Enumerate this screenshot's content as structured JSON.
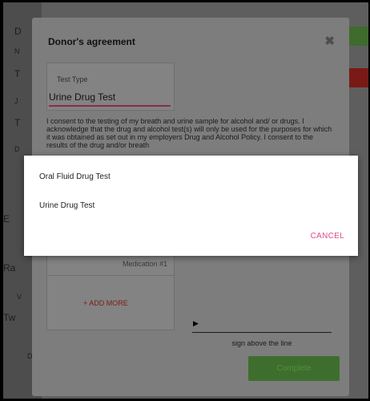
{
  "background": {
    "left_letters": [
      "D",
      "N",
      "T",
      "J",
      "T",
      "D",
      "E",
      "Ra",
      "V",
      "Tw",
      "D"
    ]
  },
  "dialog": {
    "title": "Donor's agreement",
    "close_glyph": "✖",
    "test_type": {
      "label": "Test Type",
      "value": "Urine Drug Test"
    },
    "consent_text": "I consent to the testing of my breath and urine sample for alcohol and/ or drugs. I acknowledge that the drug and alcohol test(s) will only be used for the purposes for which it was obtained as set out in my employers Drug and Alcohol Policy. I consent to the results of the drug and/or breath",
    "medication": {
      "placeholder": "Medication #1",
      "add_more_label": "+ ADD MORE"
    },
    "signature": {
      "caption": "sign above the line"
    },
    "complete_label": "Complete"
  },
  "picker": {
    "options": [
      "Oral Fluid Drug Test",
      "Urine Drug Test"
    ],
    "cancel_label": "CANCEL"
  },
  "colors": {
    "accent": "#e24a8d",
    "complete_button": "#3e6e2e",
    "add_more": "#7a1d17"
  }
}
